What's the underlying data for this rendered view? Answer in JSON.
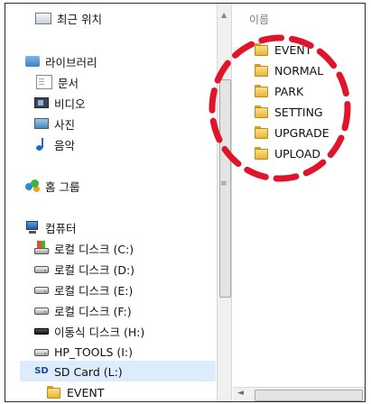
{
  "nav": {
    "items": [
      {
        "label": "최근 위치",
        "icon": "recent-places-icon"
      },
      {
        "label": "라이브러리",
        "icon": "libraries-icon"
      },
      {
        "label": "문서",
        "icon": "documents-icon"
      },
      {
        "label": "비디오",
        "icon": "videos-icon"
      },
      {
        "label": "사진",
        "icon": "pictures-icon"
      },
      {
        "label": "음악",
        "icon": "music-icon"
      },
      {
        "label": "홈 그룹",
        "icon": "homegroup-icon"
      },
      {
        "label": "컴퓨터",
        "icon": "computer-icon"
      },
      {
        "label": "로컬 디스크 (C:)",
        "icon": "system-drive-icon"
      },
      {
        "label": "로컬 디스크 (D:)",
        "icon": "drive-icon"
      },
      {
        "label": "로컬 디스크 (E:)",
        "icon": "drive-icon"
      },
      {
        "label": "로컬 디스크 (F:)",
        "icon": "drive-icon"
      },
      {
        "label": "이동식 디스크 (H:)",
        "icon": "removable-disk-icon"
      },
      {
        "label": "HP_TOOLS (I:)",
        "icon": "drive-icon"
      },
      {
        "label": "SD Card (L:)",
        "icon": "sd-card-icon",
        "icon_text": "SD",
        "selected": true
      },
      {
        "label": "EVENT",
        "icon": "folder-icon"
      }
    ]
  },
  "content": {
    "column_header": "이름",
    "folders": [
      "EVENT",
      "NORMAL",
      "PARK",
      "SETTING",
      "UPGRADE",
      "UPLOAD"
    ]
  },
  "scrollbars": {
    "up_arrow": "▲",
    "grip": "≡",
    "left_arrow": "◄"
  },
  "colors": {
    "highlight_circle": "#e0142a",
    "selection": "#dcecfc",
    "folder": "#f0c44c"
  }
}
